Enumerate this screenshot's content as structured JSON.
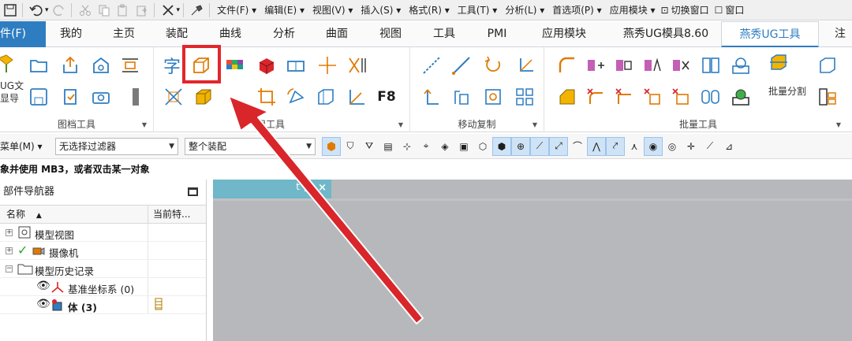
{
  "quick_access": {
    "menus": [
      "文件(F)",
      "编辑(E)",
      "视图(V)",
      "插入(S)",
      "格式(R)",
      "工具(T)",
      "分析(L)",
      "首选项(P)",
      "应用模块",
      "切换窗口",
      "窗口"
    ]
  },
  "ribbon_tabs": {
    "file": "件(F)",
    "items": [
      "我的",
      "主页",
      "装配",
      "曲线",
      "分析",
      "曲面",
      "视图",
      "工具",
      "PMI",
      "应用模块",
      "燕秀UG模具8.60",
      "燕秀UG工具",
      "注"
    ]
  },
  "ribbon": {
    "group1_label": "图档工具",
    "group1_big_text": [
      "UG文",
      "显导"
    ],
    "group2_label": "用工具",
    "group2_text_char": "字",
    "group2_f8": "F8",
    "group3_label": "移动复制",
    "group4_label": "批量工具",
    "group4_big_text": "批量分割"
  },
  "filterbar": {
    "menu_label": "菜单(M)",
    "filter_value": "无选择过滤器",
    "assembly_value": "整个装配"
  },
  "status_text": "象并使用 MB3，或者双击某一对象",
  "navigator": {
    "title": "部件导航器",
    "col_name": "名称",
    "col_current": "当前特...",
    "rows": [
      {
        "label": "模型视图"
      },
      {
        "label": "摄像机"
      },
      {
        "label": "模型历史记录"
      },
      {
        "label": "基准坐标系 (0)"
      },
      {
        "label": "体 (3)"
      }
    ]
  },
  "graphics_tab": {
    "label": "t",
    "close": "×"
  },
  "colors": {
    "accent": "#2f7dc1",
    "highlight_red": "#e2262c",
    "graphics_bg": "#b6b8bb"
  }
}
